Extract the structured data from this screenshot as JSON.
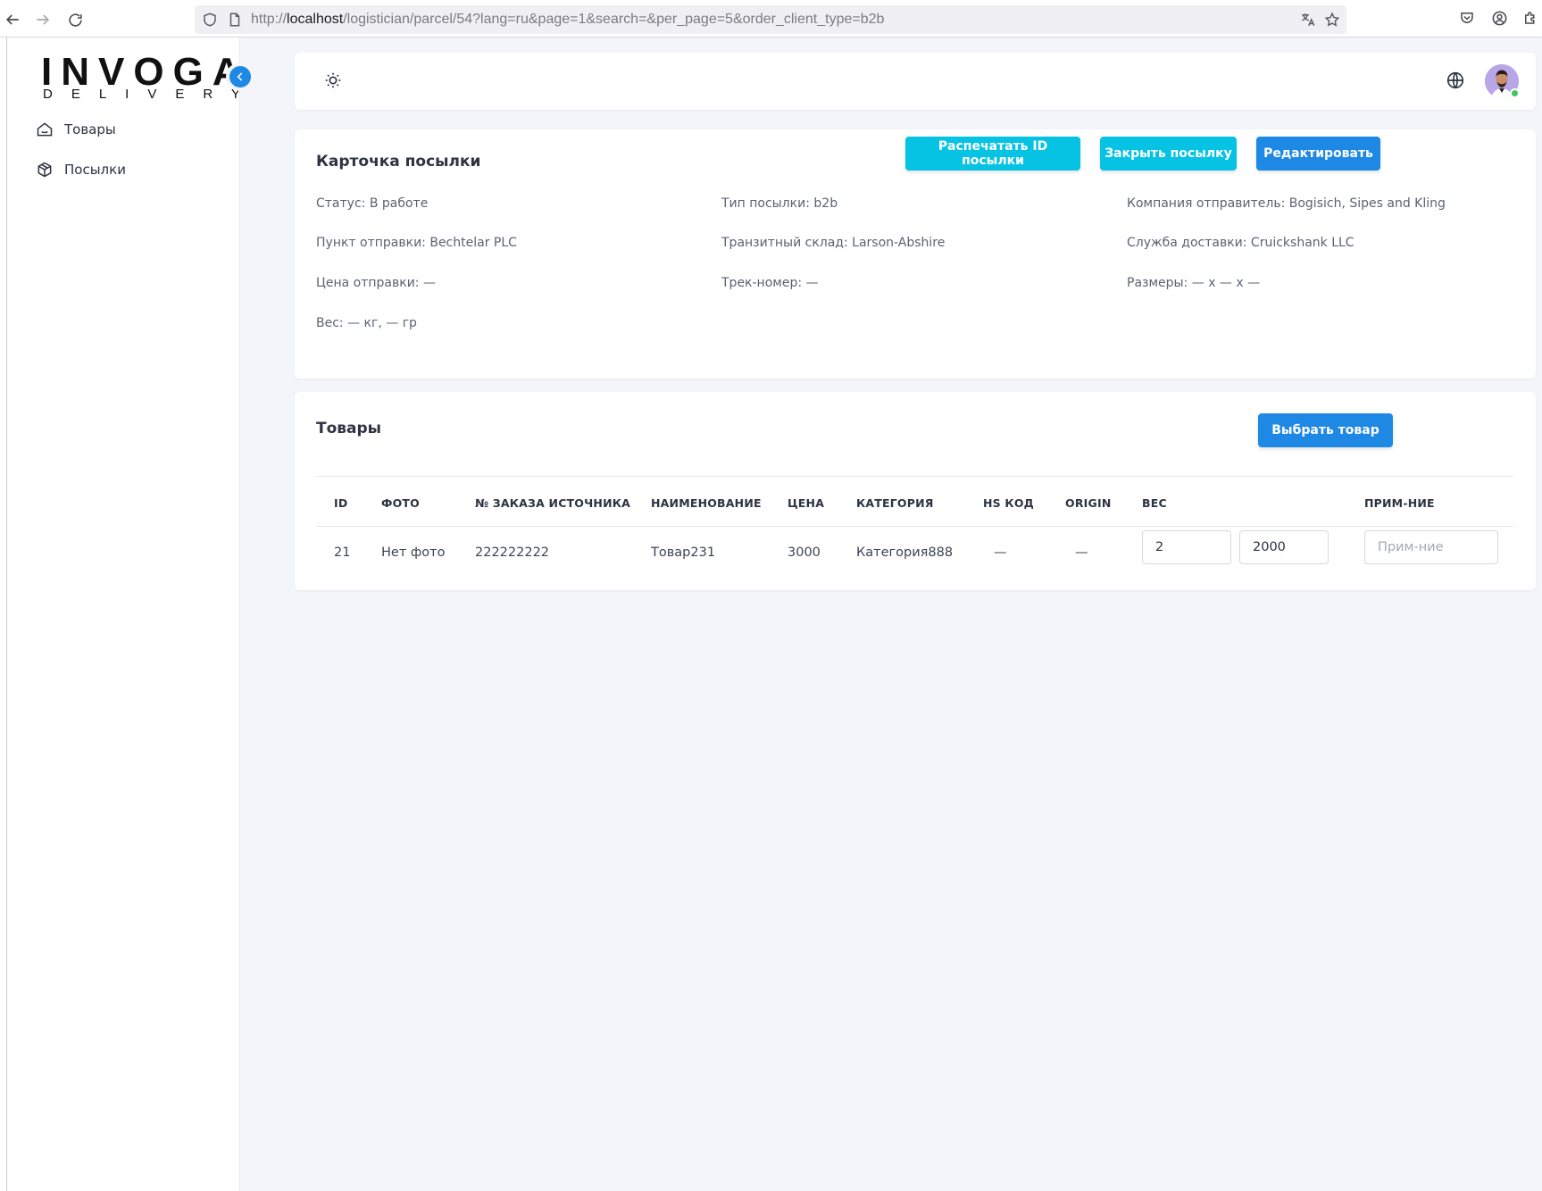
{
  "browser": {
    "url_prefix": "http://",
    "url_host": "localhost",
    "url_path": "/logistician/parcel/54?lang=ru&page=1&search=&per_page=5&order_client_type=b2b"
  },
  "sidebar": {
    "logo_main": "INVOGA",
    "logo_sub": "DELIVERY",
    "items": [
      {
        "label": "Товары",
        "icon": "home-icon"
      },
      {
        "label": "Посылки",
        "icon": "box-icon"
      }
    ]
  },
  "header": {
    "theme_icon": "sun-icon",
    "language_icon": "globe-icon",
    "avatar_icon": "user-avatar",
    "status_color": "#43c35e"
  },
  "parcel": {
    "title": "Карточка посылки",
    "buttons": {
      "print": "Распечатать ID посылки",
      "close": "Закрыть посылку",
      "edit": "Редактировать"
    },
    "fields": {
      "status": "Статус: В работе",
      "type": "Тип посылки: b2b",
      "company": "Компания отправитель: Bogisich, Sipes and Kling",
      "departure": "Пункт отправки: Bechtelar PLC",
      "transit": "Транзитный склад: Larson-Abshire",
      "delivery": "Служба доставки: Cruickshank LLC",
      "price": "Цена отправки:  —",
      "track": "Трек-номер:  —",
      "dimensions": "Размеры:  — x — x  —",
      "weight": "Вес:  — кг,  — гр"
    }
  },
  "goods": {
    "title": "Товары",
    "select_button": "Выбрать товар",
    "columns": [
      "ID",
      "ФОТО",
      "№ ЗАКАЗА ИСТОЧНИКА",
      "НАИМЕНОВАНИЕ",
      "ЦЕНА",
      "КАТЕГОРИЯ",
      "HS КОД",
      "ORIGIN",
      "ВЕС",
      "ПРИМ-НИЕ"
    ],
    "rows": [
      {
        "id": "21",
        "photo": "Нет фото",
        "source_order": "222222222",
        "name": "Товар231",
        "price": "3000",
        "category": "Категория888",
        "hs_code": "—",
        "origin": "—",
        "weight_kg": "2",
        "weight_g": "2000",
        "note_placeholder": "Прим-ние"
      }
    ]
  },
  "colors": {
    "primary": "#1e88e5",
    "cyan": "#06c2e3",
    "background": "#f4f5fa"
  }
}
